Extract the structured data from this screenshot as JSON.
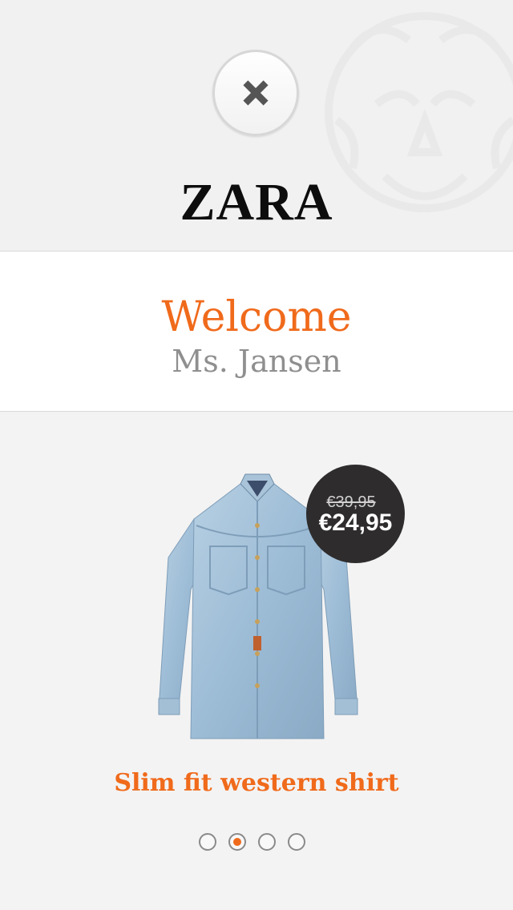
{
  "header": {
    "close_icon": "close-icon",
    "brand": "ZARA"
  },
  "welcome": {
    "title": "Welcome",
    "name": "Ms. Jansen"
  },
  "product": {
    "image": "denim-shirt",
    "price_old": "€39,95",
    "price_new": "€24,95",
    "name": "Slim fit western shirt"
  },
  "pager": {
    "count": 4,
    "active_index": 1
  },
  "colors": {
    "accent": "#f06a1b",
    "badge": "#2e2c2d",
    "muted_text": "#8f8f8f"
  }
}
